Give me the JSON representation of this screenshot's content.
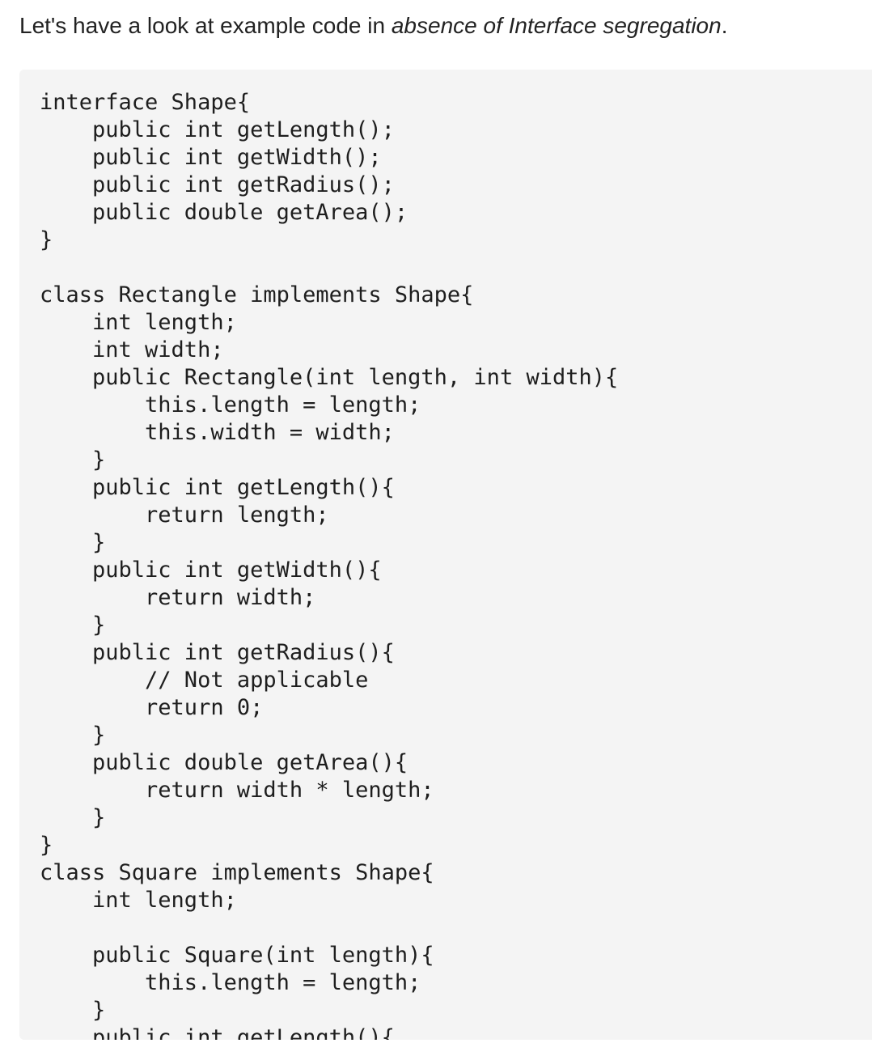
{
  "intro": {
    "text_before": "Let's have a look at example code in ",
    "emphasis": "absence of Interface segregation",
    "text_after": "."
  },
  "code_lines": [
    "interface Shape{",
    "    public int getLength();",
    "    public int getWidth();",
    "    public int getRadius();",
    "    public double getArea();",
    "}",
    "",
    "class Rectangle implements Shape{",
    "    int length;",
    "    int width;",
    "    public Rectangle(int length, int width){",
    "        this.length = length;",
    "        this.width = width;",
    "    }",
    "    public int getLength(){",
    "        return length;",
    "    }",
    "    public int getWidth(){",
    "        return width;",
    "    }",
    "    public int getRadius(){",
    "        // Not applicable",
    "        return 0;",
    "    }",
    "    public double getArea(){",
    "        return width * length;",
    "    }",
    "}",
    "class Square implements Shape{",
    "    int length;",
    "",
    "    public Square(int length){",
    "        this.length = length;",
    "    }",
    "    public int getLength(){"
  ]
}
